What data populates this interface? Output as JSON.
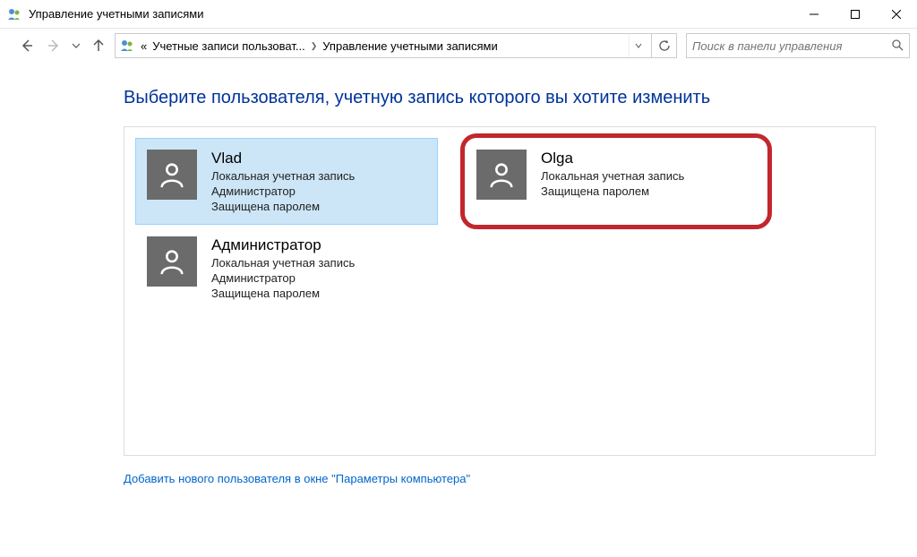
{
  "window": {
    "title": "Управление учетными записями"
  },
  "breadcrumb": {
    "seg1": "Учетные записи пользоват...",
    "seg2": "Управление учетными записями",
    "prefix": "«"
  },
  "search": {
    "placeholder": "Поиск в панели управления"
  },
  "heading": "Выберите пользователя, учетную запись которого вы хотите изменить",
  "users": [
    {
      "name": "Vlad",
      "line1": "Локальная учетная запись",
      "line2": "Администратор",
      "line3": "Защищена паролем"
    },
    {
      "name": "Olga",
      "line1": "Локальная учетная запись",
      "line2": "Защищена паролем",
      "line3": ""
    },
    {
      "name": "Администратор",
      "line1": "Локальная учетная запись",
      "line2": "Администратор",
      "line3": "Защищена паролем"
    }
  ],
  "addlink": "Добавить нового пользователя в окне \"Параметры компьютера\""
}
